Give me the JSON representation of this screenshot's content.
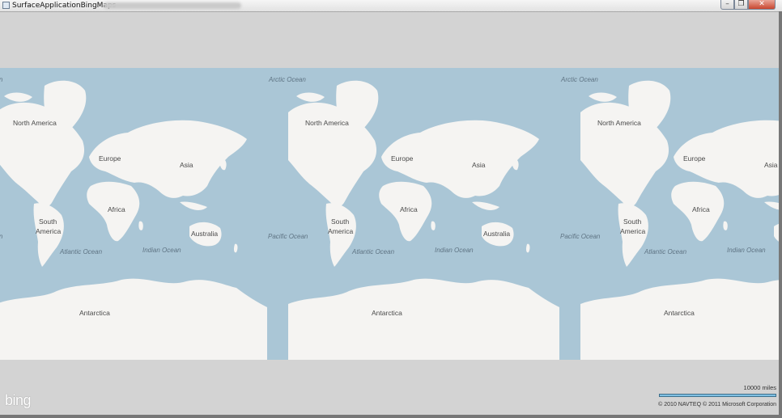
{
  "window": {
    "title": "SurfaceApplicationBingMaps",
    "controls": {
      "minimize": "–",
      "maximize": "❐",
      "close": "✕"
    }
  },
  "map": {
    "copies": 3,
    "continents": [
      "North America",
      "Europe",
      "Asia",
      "Africa",
      "South America",
      "Australia",
      "Antarctica"
    ],
    "oceans": [
      "Arctic Ocean",
      "Pacific Ocean",
      "Atlantic Ocean",
      "Indian Ocean"
    ],
    "colors": {
      "water": "#aac6d6",
      "land": "#f5f4f2",
      "background": "#d3d3d3"
    }
  },
  "logo": "bing",
  "scale": {
    "label": "10000 miles"
  },
  "copyright": "© 2010 NAVTEQ   © 2011 Microsoft Corporation"
}
